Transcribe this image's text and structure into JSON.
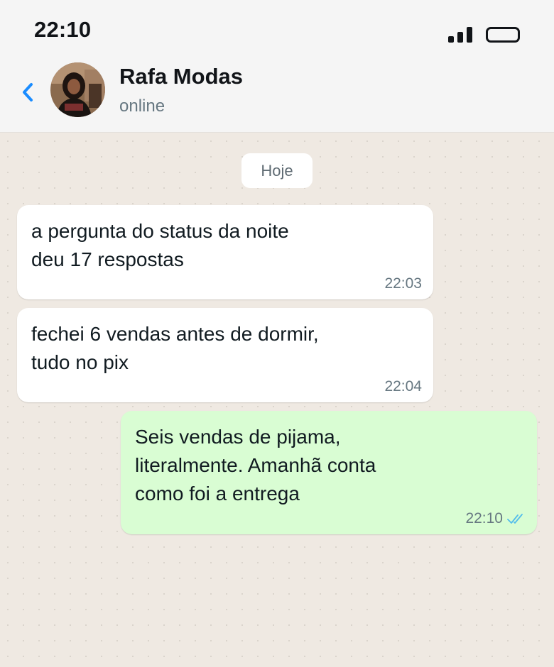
{
  "status_bar": {
    "time": "22:10"
  },
  "contact": {
    "name": "Rafa Modas",
    "status": "online",
    "avatar_icon": "avatar-photo"
  },
  "day_separator": "Hoje",
  "messages": [
    {
      "direction": "in",
      "text": "a pergunta do status da noite\ndeu 17 respostas",
      "time": "22:03"
    },
    {
      "direction": "in",
      "text": "fechei 6 vendas antes de dormir,\ntudo no pix",
      "time": "22:04"
    },
    {
      "direction": "out",
      "text": "Seis vendas de pijama,\nliteralmente. Amanhã conta\ncomo foi a entrega",
      "time": "22:10",
      "read_receipt": "double-check-read"
    }
  ],
  "colors": {
    "back_arrow": "#1a8cff",
    "incoming_bubble": "#ffffff",
    "outgoing_bubble": "#d9fdd3",
    "chat_background": "#efe9e2",
    "read_ticks": "#53bdeb"
  }
}
